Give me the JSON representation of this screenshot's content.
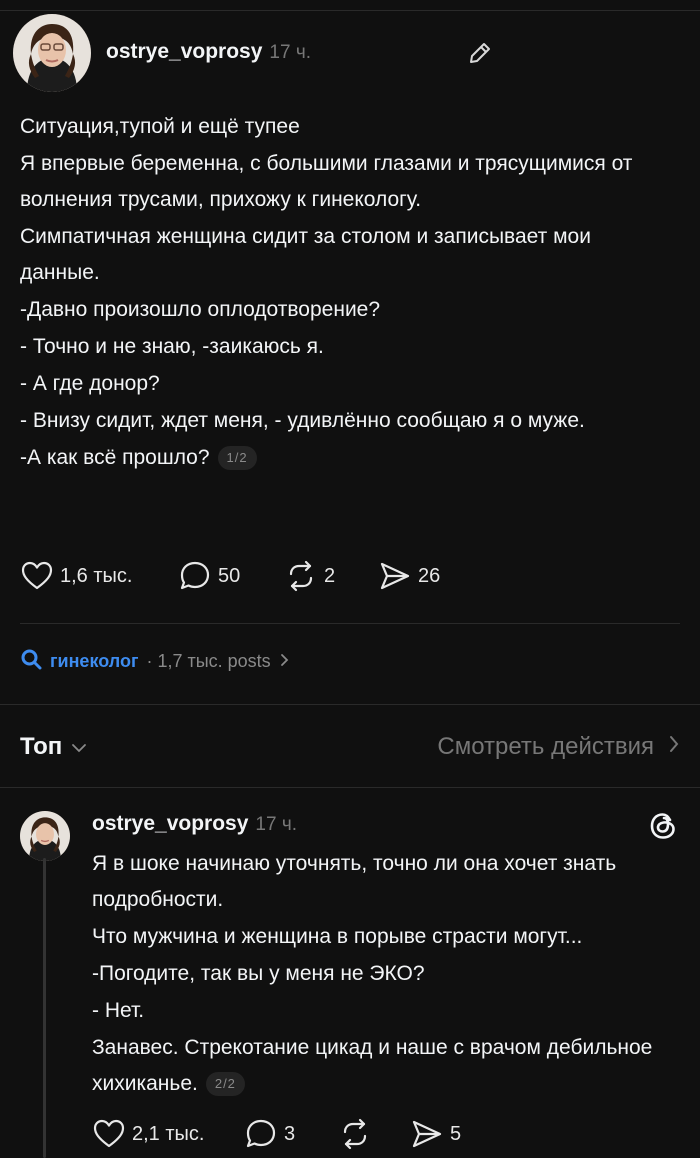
{
  "post": {
    "username": "ostrye_voprosy",
    "time": "17 ч.",
    "paragraphs": [
      "Ситуация,тупой и ещё тупее",
      "Я впервые беременна, с большими глазами и трясущимися от волнения трусами, прихожу к гинекологу.",
      "Симпатичная женщина сидит за столом и записывает мои данные.",
      "-Давно произошло оплодотворение?",
      "- Точно и не знаю, -заикаюсь я.",
      "- А где донор?",
      "- Внизу сидит, ждет меня, - удивлённо сообщаю я о муже.",
      "-А как всё прошло?"
    ],
    "page_badge": "1/2",
    "likes": "1,6 тыс.",
    "comments": "50",
    "reposts": "2",
    "shares": "26"
  },
  "tag": {
    "name": "гинеколог",
    "meta": "· 1,7 тыс. posts"
  },
  "section": {
    "sort_label": "Топ",
    "activity_label": "Смотреть действия"
  },
  "reply": {
    "username": "ostrye_voprosy",
    "time": "17 ч.",
    "paragraphs": [
      "Я в шоке начинаю уточнять, точно ли она хочет знать подробности.",
      "Что мужчина и женщина в порыве страсти могут...",
      "-Погодите, так вы у меня не ЭКО?",
      "- Нет.",
      "Занавес. Стрекотание цикад и наше с врачом дебильное хихиканье."
    ],
    "page_badge": "2/2",
    "likes": "2,1 тыс.",
    "comments": "3",
    "shares": "5"
  },
  "icons": {
    "edit": "pencil-icon",
    "like": "heart-icon",
    "comment": "comment-bubble-icon",
    "repost": "repost-icon",
    "share": "send-icon",
    "search": "search-icon",
    "threads": "threads-logo-icon"
  },
  "colors": {
    "background": "#101010",
    "text": "#f3f5f7",
    "muted": "#777777",
    "tag_blue": "#3e8cf0"
  }
}
